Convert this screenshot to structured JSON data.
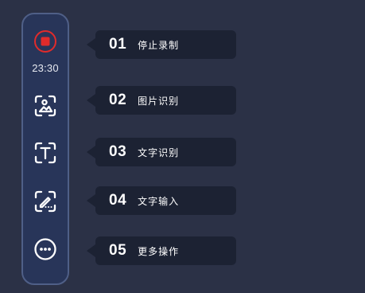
{
  "toolbar": {
    "timer": "23:30",
    "buttons": [
      {
        "name": "stop-recording",
        "icon": "stop-icon"
      },
      {
        "name": "image-recognition",
        "icon": "image-scan-icon"
      },
      {
        "name": "text-recognition",
        "icon": "text-scan-icon"
      },
      {
        "name": "text-input",
        "icon": "pen-input-icon"
      },
      {
        "name": "more-actions",
        "icon": "more-dots-icon"
      }
    ]
  },
  "tips": [
    {
      "num": "01",
      "label": "停止录制"
    },
    {
      "num": "02",
      "label": "图片识别"
    },
    {
      "num": "03",
      "label": "文字识别"
    },
    {
      "num": "04",
      "label": "文字输入"
    },
    {
      "num": "05",
      "label": "更多操作"
    }
  ],
  "colors": {
    "background": "#2b3146",
    "toolbar_bg": "#283559",
    "toolbar_border": "#4f5f87",
    "stop_red": "#e02b2b",
    "tooltip_bg": "#1c2233",
    "text": "#ffffff"
  }
}
